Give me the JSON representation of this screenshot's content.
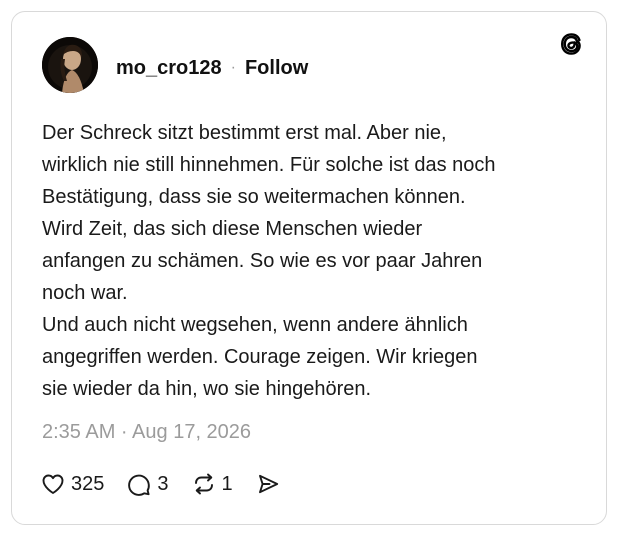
{
  "post": {
    "username": "mo_cro128",
    "separator": "·",
    "follow_label": "Follow",
    "text_lines": [
      "Der Schreck sitzt bestimmt erst mal. Aber nie,",
      "wirklich nie still hinnehmen. Für solche ist das noch",
      "Bestätigung, dass sie so weitermachen können.",
      "Wird Zeit, das sich diese Menschen wieder",
      "anfangen zu schämen. So wie es vor paar Jahren",
      "noch war.",
      "Und auch nicht wegsehen, wenn andere ähnlich",
      "angegriffen werden. Courage zeigen. Wir kriegen",
      "sie wieder da hin, wo sie hingehören."
    ],
    "timestamp": "2:35 AM · Aug 17, 2026"
  },
  "actions": {
    "likes": "325",
    "replies": "3",
    "reposts": "1"
  },
  "icons": {
    "brand": "threads-logo-icon",
    "like": "heart-icon",
    "reply": "comment-icon",
    "repost": "repost-icon",
    "share": "share-icon"
  },
  "colors": {
    "text": "#111111",
    "muted": "#9b9b9b",
    "border": "#d9d9d9",
    "background": "#ffffff"
  }
}
